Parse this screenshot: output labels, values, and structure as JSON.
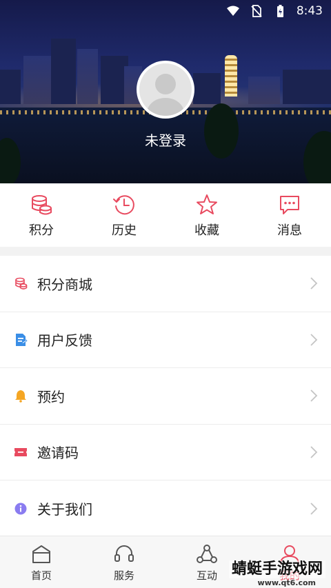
{
  "status_bar": {
    "time": "8:43"
  },
  "profile": {
    "login_text": "未登录"
  },
  "quick_actions": [
    {
      "label": "积分",
      "icon": "coins-icon"
    },
    {
      "label": "历史",
      "icon": "history-icon"
    },
    {
      "label": "收藏",
      "icon": "star-icon"
    },
    {
      "label": "消息",
      "icon": "message-icon"
    }
  ],
  "menu": [
    {
      "label": "积分商城",
      "icon": "points-mall-icon"
    },
    {
      "label": "用户反馈",
      "icon": "feedback-icon"
    },
    {
      "label": "预约",
      "icon": "bell-icon"
    },
    {
      "label": "邀请码",
      "icon": "ticket-icon"
    },
    {
      "label": "关于我们",
      "icon": "info-icon"
    }
  ],
  "tabbar": [
    {
      "label": "首页",
      "icon": "home-icon"
    },
    {
      "label": "服务",
      "icon": "headset-icon"
    },
    {
      "label": "互动",
      "icon": "share-network-icon"
    },
    {
      "label": "我的",
      "icon": "user-icon"
    }
  ],
  "watermark": {
    "text": "蜻蜓手游戏网",
    "url": "www.qt6.com"
  },
  "colors": {
    "accent": "#e84a5f",
    "feedback_blue": "#3a8ee6",
    "bell_orange": "#f5a623",
    "info_purple": "#8a7cf0"
  }
}
